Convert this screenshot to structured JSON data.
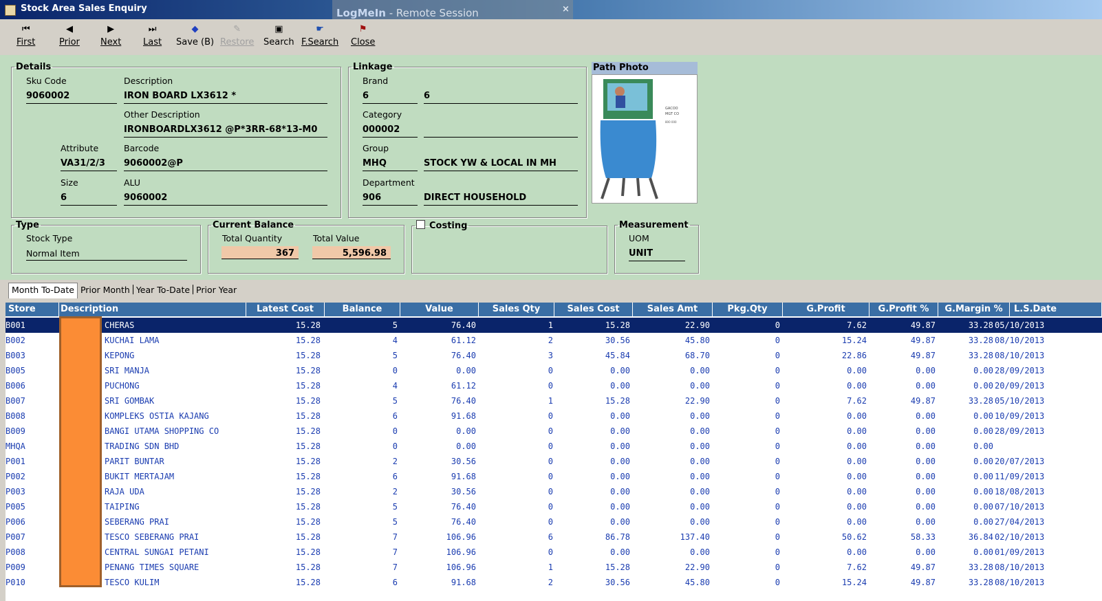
{
  "window": {
    "title": "Stock Area Sales Enquiry"
  },
  "remote": {
    "brand": "LogMeIn",
    "session": " -  Remote Session",
    "close": "×"
  },
  "toolbar": {
    "first": "First",
    "prior": "Prior",
    "next": "Next",
    "last": "Last",
    "save": "Save (B)",
    "restore": "Restore",
    "search": "Search",
    "fsearch": "F.Search",
    "close": "Close"
  },
  "details": {
    "legend": "Details",
    "sku_label": "Sku Code",
    "sku": "9060002",
    "desc_label": "Description",
    "desc": "IRON BOARD LX3612 *",
    "other_label": "Other Description",
    "other": "IRONBOARDLX3612 @P*3RR-68*13-M0",
    "attr_label": "Attribute",
    "attr": "VA31/2/3",
    "barcode_label": "Barcode",
    "barcode": "9060002@P",
    "size_label": "Size",
    "size": "6",
    "alu_label": "ALU",
    "alu": "9060002"
  },
  "linkage": {
    "legend": "Linkage",
    "brand_label": "Brand",
    "brand_code": "6",
    "brand_name": "6",
    "category_label": "Category",
    "category_code": "000002",
    "category_name": "",
    "group_label": "Group",
    "group_code": "MHQ",
    "group_name": "STOCK YW & LOCAL IN MH",
    "dept_label": "Department",
    "dept_code": "906",
    "dept_name": "DIRECT HOUSEHOLD"
  },
  "photo": {
    "title": "Path Photo"
  },
  "type": {
    "legend": "Type",
    "label": "Stock Type",
    "value": "Normal Item"
  },
  "balance": {
    "legend": "Current Balance",
    "qty_label": "Total Quantity",
    "qty": "367",
    "value_label": "Total Value",
    "value": "5,596.98"
  },
  "costing": {
    "legend": "Costing"
  },
  "measurement": {
    "legend": "Measurement",
    "uom_label": "UOM",
    "uom": "UNIT"
  },
  "tabs": [
    "Month To-Date",
    "Prior Month",
    "Year To-Date",
    "Prior Year"
  ],
  "columns": [
    "Store",
    "Description",
    "Latest Cost",
    "Balance",
    "Value",
    "Sales Qty",
    "Sales Cost",
    "Sales Amt",
    "Pkg.Qty",
    "G.Profit",
    "G.Profit %",
    "G.Margin %",
    "L.S.Date"
  ],
  "rows": [
    [
      "B001",
      "CHERAS",
      "15.28",
      "5",
      "76.40",
      "1",
      "15.28",
      "22.90",
      "0",
      "7.62",
      "49.87",
      "33.28",
      "05/10/2013"
    ],
    [
      "B002",
      "KUCHAI LAMA",
      "15.28",
      "4",
      "61.12",
      "2",
      "30.56",
      "45.80",
      "0",
      "15.24",
      "49.87",
      "33.28",
      "08/10/2013"
    ],
    [
      "B003",
      "KEPONG",
      "15.28",
      "5",
      "76.40",
      "3",
      "45.84",
      "68.70",
      "0",
      "22.86",
      "49.87",
      "33.28",
      "08/10/2013"
    ],
    [
      "B005",
      "SRI MANJA",
      "15.28",
      "0",
      "0.00",
      "0",
      "0.00",
      "0.00",
      "0",
      "0.00",
      "0.00",
      "0.00",
      "28/09/2013"
    ],
    [
      "B006",
      "PUCHONG",
      "15.28",
      "4",
      "61.12",
      "0",
      "0.00",
      "0.00",
      "0",
      "0.00",
      "0.00",
      "0.00",
      "20/09/2013"
    ],
    [
      "B007",
      "SRI GOMBAK",
      "15.28",
      "5",
      "76.40",
      "1",
      "15.28",
      "22.90",
      "0",
      "7.62",
      "49.87",
      "33.28",
      "05/10/2013"
    ],
    [
      "B008",
      "KOMPLEKS OSTIA KAJANG",
      "15.28",
      "6",
      "91.68",
      "0",
      "0.00",
      "0.00",
      "0",
      "0.00",
      "0.00",
      "0.00",
      "10/09/2013"
    ],
    [
      "B009",
      "BANGI UTAMA SHOPPING CO",
      "15.28",
      "0",
      "0.00",
      "0",
      "0.00",
      "0.00",
      "0",
      "0.00",
      "0.00",
      "0.00",
      "28/09/2013"
    ],
    [
      "MHQA",
      "TRADING SDN BHD",
      "15.28",
      "0",
      "0.00",
      "0",
      "0.00",
      "0.00",
      "0",
      "0.00",
      "0.00",
      "0.00",
      ""
    ],
    [
      "P001",
      "PARIT BUNTAR",
      "15.28",
      "2",
      "30.56",
      "0",
      "0.00",
      "0.00",
      "0",
      "0.00",
      "0.00",
      "0.00",
      "20/07/2013"
    ],
    [
      "P002",
      "BUKIT MERTAJAM",
      "15.28",
      "6",
      "91.68",
      "0",
      "0.00",
      "0.00",
      "0",
      "0.00",
      "0.00",
      "0.00",
      "11/09/2013"
    ],
    [
      "P003",
      "RAJA UDA",
      "15.28",
      "2",
      "30.56",
      "0",
      "0.00",
      "0.00",
      "0",
      "0.00",
      "0.00",
      "0.00",
      "18/08/2013"
    ],
    [
      "P005",
      "TAIPING",
      "15.28",
      "5",
      "76.40",
      "0",
      "0.00",
      "0.00",
      "0",
      "0.00",
      "0.00",
      "0.00",
      "07/10/2013"
    ],
    [
      "P006",
      "SEBERANG PRAI",
      "15.28",
      "5",
      "76.40",
      "0",
      "0.00",
      "0.00",
      "0",
      "0.00",
      "0.00",
      "0.00",
      "27/04/2013"
    ],
    [
      "P007",
      "TESCO SEBERANG PRAI",
      "15.28",
      "7",
      "106.96",
      "6",
      "86.78",
      "137.40",
      "0",
      "50.62",
      "58.33",
      "36.84",
      "02/10/2013"
    ],
    [
      "P008",
      "CENTRAL SUNGAI PETANI",
      "15.28",
      "7",
      "106.96",
      "0",
      "0.00",
      "0.00",
      "0",
      "0.00",
      "0.00",
      "0.00",
      "01/09/2013"
    ],
    [
      "P009",
      "PENANG TIMES SQUARE",
      "15.28",
      "7",
      "106.96",
      "1",
      "15.28",
      "22.90",
      "0",
      "7.62",
      "49.87",
      "33.28",
      "08/10/2013"
    ],
    [
      "P010",
      "TESCO KULIM",
      "15.28",
      "6",
      "91.68",
      "2",
      "30.56",
      "45.80",
      "0",
      "15.24",
      "49.87",
      "33.28",
      "08/10/2013"
    ]
  ]
}
